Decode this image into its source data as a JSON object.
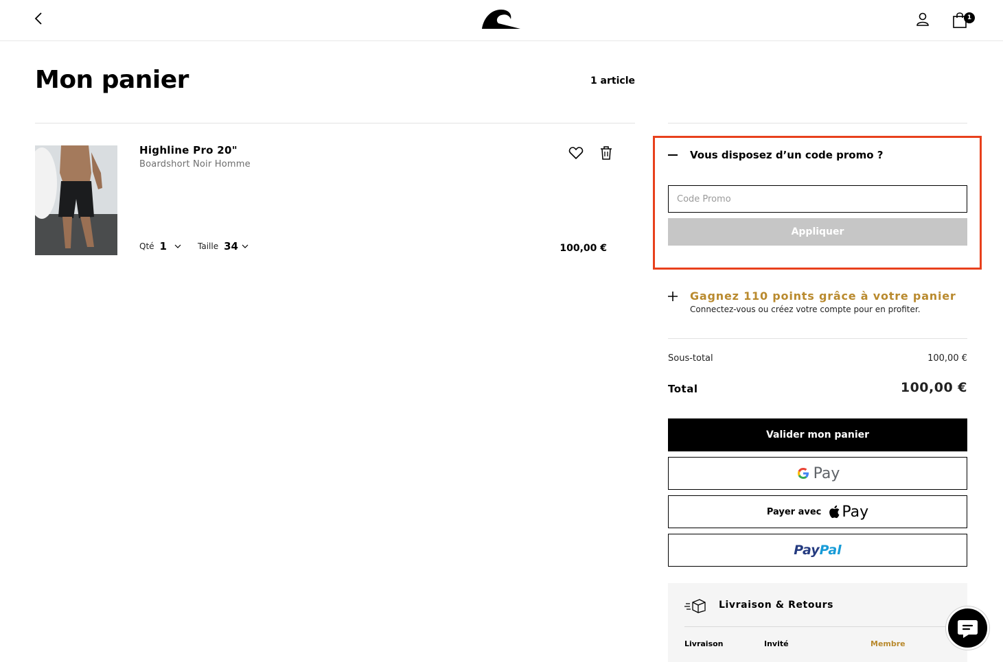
{
  "header": {
    "cart_count": "1"
  },
  "page": {
    "title": "Mon panier",
    "item_count": "1 article"
  },
  "cart_item": {
    "name": "Highline Pro 20\"",
    "description": "Boardshort Noir Homme",
    "qty_label": "Qté",
    "qty_value": "1",
    "size_label": "Taille",
    "size_value": "34",
    "price": "100,00 €"
  },
  "promo": {
    "title": "Vous disposez d’un code promo ?",
    "placeholder": "Code Promo",
    "apply_label": "Appliquer"
  },
  "loyalty": {
    "title": "Gagnez 110 points grâce à votre panier",
    "subtitle": "Connectez-vous ou créez votre compte pour en profiter."
  },
  "summary": {
    "subtotal_label": "Sous-total",
    "subtotal_value": "100,00 €",
    "total_label": "Total",
    "total_value": "100,00 €"
  },
  "payment": {
    "checkout_label": "Valider mon panier",
    "gpay_label": "Pay",
    "applepay_prefix": "Payer avec",
    "applepay_label": "Pay",
    "paypal_pay": "Pay",
    "paypal_pal": "Pal"
  },
  "delivery": {
    "title": "Livraison & Retours",
    "col_livraison": "Livraison",
    "col_invite": "Invité",
    "col_membre": "Membre"
  },
  "colors": {
    "accent_gold": "#b98a2e",
    "highlight": "#e8401c",
    "disabled_button": "#c6c6c6"
  },
  "icons": [
    "chevron-left-icon",
    "quiksilver-logo",
    "user-icon",
    "shopping-bag-icon",
    "heart-icon",
    "trash-icon",
    "chevron-down-icon",
    "minus-icon",
    "plus-icon",
    "google-g-icon",
    "apple-icon",
    "delivery-box-icon",
    "chat-icon"
  ]
}
